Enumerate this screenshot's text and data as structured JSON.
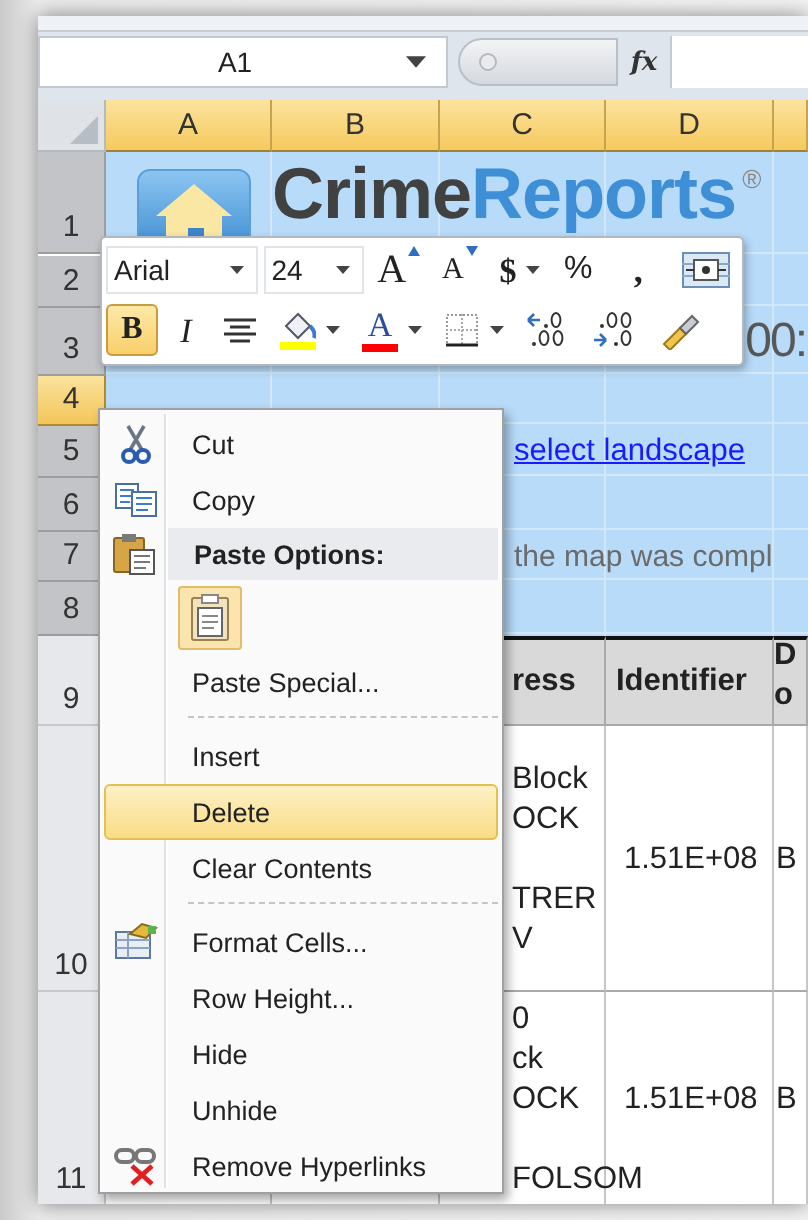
{
  "name_box": {
    "value": "A1"
  },
  "formula_bar": {
    "function_label": "fx"
  },
  "sheet": {
    "columns": [
      {
        "label": "A",
        "selected": true
      },
      {
        "label": "B",
        "selected": true
      },
      {
        "label": "C",
        "selected": true
      },
      {
        "label": "D",
        "selected": true
      },
      {
        "selected": true
      }
    ],
    "rows": [
      {
        "label": "1",
        "kind": "banner",
        "selected": true,
        "active": false
      },
      {
        "label": "2",
        "kind": "banner",
        "selected": true,
        "active": false
      },
      {
        "label": "3",
        "kind": "banner",
        "selected": true,
        "active": false
      },
      {
        "label": "4",
        "kind": "banner",
        "selected": true,
        "active": true
      },
      {
        "label": "5",
        "kind": "banner",
        "selected": true,
        "active": false
      },
      {
        "label": "6",
        "kind": "banner",
        "selected": true,
        "active": false
      },
      {
        "label": "7",
        "kind": "banner",
        "selected": true,
        "active": false
      },
      {
        "label": "8",
        "kind": "banner",
        "selected": true,
        "active": false
      },
      {
        "label": "9",
        "kind": "table-header",
        "selected": false,
        "active": false
      },
      {
        "label": "10",
        "kind": "table-row",
        "selected": false,
        "active": false
      },
      {
        "label": "11",
        "kind": "table-row",
        "selected": false,
        "active": false
      }
    ],
    "banner": {
      "wordmark": [
        {
          "text": "Crime",
          "color": "#414141"
        },
        {
          "text": "Reports",
          "color": "#3f8fd6"
        }
      ],
      "registered": "®",
      "title_fragment": "00:",
      "link": "select landscape",
      "note": "the map was compl"
    },
    "table": {
      "header": [
        "ress",
        "Identifier",
        "D o"
      ],
      "rows": [
        {
          "address_blocks": [
            [
              "Block",
              "OCK"
            ],
            [
              "TRER",
              "V"
            ]
          ],
          "identifier": "1.51E+08",
          "column_5": "B"
        },
        {
          "address_blocks": [
            [
              "0",
              "ck",
              "OCK"
            ],
            [
              "FOLSOM"
            ]
          ],
          "identifier": "1.51E+08",
          "column_5": "B"
        }
      ]
    }
  },
  "mini_toolbar": {
    "font": "Arial",
    "size": "24",
    "top_row": [
      {
        "kind": "grow-font",
        "text": "A",
        "selected": false
      },
      {
        "kind": "shrink-font",
        "text": "A",
        "selected": false
      },
      {
        "kind": "currency",
        "text": "$",
        "dropdown": true,
        "selected": false
      },
      {
        "kind": "percent",
        "text": "%",
        "selected": false
      },
      {
        "kind": "comma",
        "text": ",",
        "selected": false
      },
      {
        "kind": "merge-center",
        "selected": false
      }
    ],
    "bottom_row": [
      {
        "kind": "bold",
        "text": "B",
        "selected": true
      },
      {
        "kind": "italic",
        "text": "I",
        "selected": false
      },
      {
        "kind": "align-center",
        "selected": false
      },
      {
        "kind": "fill-color",
        "color": "#ffff00",
        "dropdown": true,
        "selected": false
      },
      {
        "kind": "font-color",
        "text": "A",
        "color": "#ff0000",
        "dropdown": true,
        "selected": false
      },
      {
        "kind": "borders",
        "dropdown": true,
        "selected": false
      },
      {
        "kind": "increase-decimal",
        "selected": false
      },
      {
        "kind": "decrease-decimal",
        "selected": false
      },
      {
        "kind": "format-painter",
        "selected": false
      }
    ]
  },
  "context_menu": {
    "items": [
      {
        "kind": "item",
        "label": "Cut",
        "selected": false
      },
      {
        "kind": "item",
        "label": "Copy",
        "selected": false
      },
      {
        "kind": "header",
        "label": "Paste Options:"
      },
      {
        "kind": "paste-options",
        "options": [
          {
            "selected": true
          }
        ]
      },
      {
        "kind": "item",
        "label": "Paste Special...",
        "selected": false
      },
      {
        "kind": "separator"
      },
      {
        "kind": "item",
        "label": "Insert",
        "selected": false
      },
      {
        "kind": "item",
        "label": "Delete",
        "selected": true
      },
      {
        "kind": "item",
        "label": "Clear Contents",
        "selected": false
      },
      {
        "kind": "separator"
      },
      {
        "kind": "item",
        "label": "Format Cells...",
        "selected": false
      },
      {
        "kind": "item",
        "label": "Row Height...",
        "selected": false
      },
      {
        "kind": "item",
        "label": "Hide",
        "selected": false
      },
      {
        "kind": "item",
        "label": "Unhide",
        "selected": false
      },
      {
        "kind": "item",
        "label": "Remove Hyperlinks",
        "selected": false
      }
    ]
  }
}
